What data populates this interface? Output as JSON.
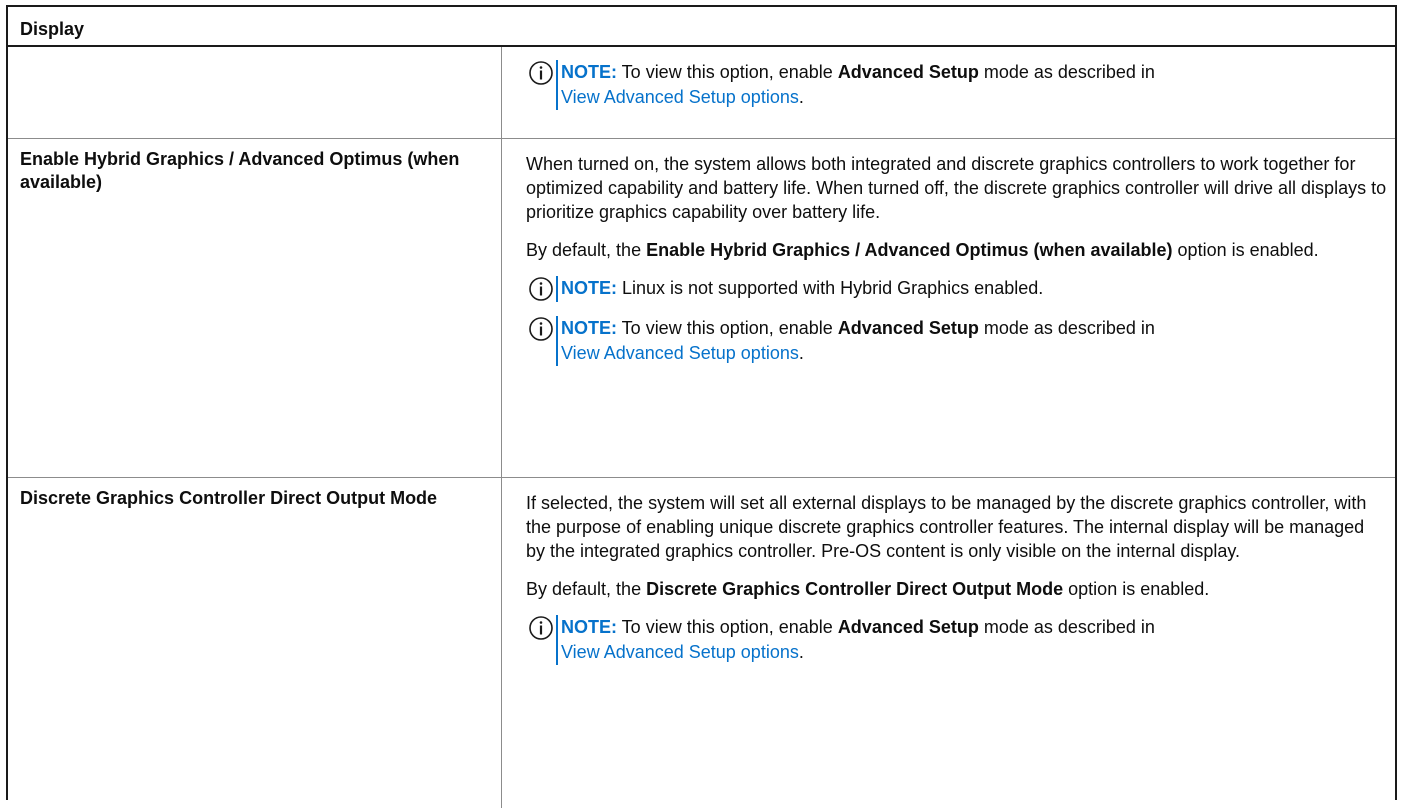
{
  "table": {
    "header": "Display",
    "rows": [
      {
        "name": "",
        "note1": {
          "label": "NOTE:",
          "text_before": " To view this option, enable ",
          "bold": "Advanced Setup",
          "text_after": " mode as described in",
          "link": "View Advanced Setup options",
          "end": "."
        }
      },
      {
        "name": "Enable Hybrid Graphics / Advanced Optimus (when available)",
        "para1": "When turned on, the system allows both integrated and discrete graphics controllers to work together for optimized capability and battery life. When turned off, the discrete graphics controller will drive all displays to prioritize graphics capability over battery life.",
        "para2": {
          "before": "By default, the ",
          "bold": "Enable Hybrid Graphics / Advanced Optimus (when available)",
          "after": " option is enabled."
        },
        "note1": {
          "label": "NOTE:",
          "text": " Linux is not supported with Hybrid Graphics enabled."
        },
        "note2": {
          "label": "NOTE:",
          "text_before": " To view this option, enable ",
          "bold": "Advanced Setup",
          "text_after": " mode as described in",
          "link": "View Advanced Setup options",
          "end": "."
        }
      },
      {
        "name": "Discrete Graphics Controller Direct Output Mode",
        "para1": "If selected, the system will set all external displays to be managed by the discrete graphics controller, with the purpose of enabling unique discrete graphics controller features. The internal display will be managed by the integrated graphics controller. Pre-OS content is only visible on the internal display.",
        "para2": {
          "before": "By default, the ",
          "bold": "Discrete Graphics Controller Direct Output Mode",
          "after": " option is enabled."
        },
        "note1": {
          "label": "NOTE:",
          "text_before": " To view this option, enable ",
          "bold": "Advanced Setup",
          "text_after": " mode as described in",
          "link": "View Advanced Setup options",
          "end": "."
        }
      }
    ]
  },
  "icons": {
    "note": "info-circle-icon"
  },
  "colors": {
    "accent": "#0672cb",
    "text": "#0e0e0e"
  }
}
